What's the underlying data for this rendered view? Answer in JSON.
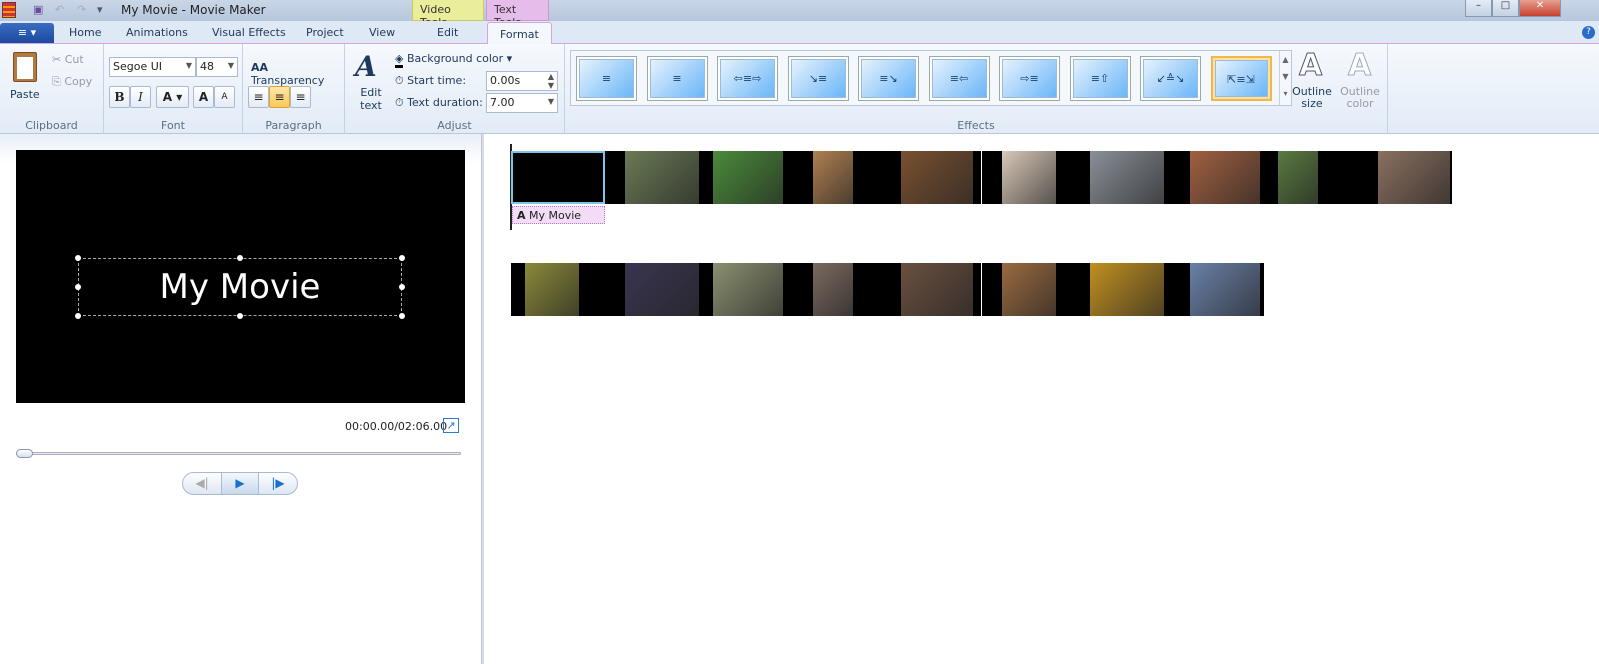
{
  "window": {
    "title": "My Movie - Movie Maker",
    "context_tabs": {
      "video": "Video Tools",
      "text": "Text Tools"
    },
    "controls": {
      "minimize": "–",
      "maximize": "□",
      "close": "✕"
    },
    "help": "?"
  },
  "quick_access": {
    "save": "save-icon",
    "undo": "undo-icon",
    "redo": "redo-icon",
    "customize": "▾"
  },
  "tabs": {
    "file": "≡ ▾",
    "home": "Home",
    "animations": "Animations",
    "visual_effects": "Visual Effects",
    "project": "Project",
    "view": "View",
    "edit": "Edit",
    "format": "Format"
  },
  "ribbon": {
    "clipboard": {
      "label": "Clipboard",
      "paste": "Paste",
      "cut": "Cut",
      "copy": "Copy"
    },
    "font": {
      "label": "Font",
      "family": "Segoe UI",
      "size": "48",
      "bold": "B",
      "italic": "I",
      "color": "A",
      "grow": "A",
      "shrink": "A"
    },
    "paragraph": {
      "label": "Paragraph",
      "transparency": "Transparency",
      "align_selected": "center"
    },
    "adjust": {
      "label": "Adjust",
      "edit_text": "Edit text",
      "background_color": "Background color",
      "start_time_label": "Start time:",
      "start_time": "0.00s",
      "duration_label": "Text duration:",
      "duration": "7.00"
    },
    "effects": {
      "label": "Effects",
      "items": [
        "≡",
        "≡",
        "⇦≡⇨",
        "↘≡",
        "≡↘",
        "≡⇦",
        "⇨≡",
        "≡⇧",
        "↙≙↘",
        "⇱≡⇲"
      ],
      "selected_index": 9,
      "outline_size": "Outline size",
      "outline_color": "Outline color"
    }
  },
  "preview": {
    "text": "My Movie",
    "timecode": "00:00.00/02:06.00",
    "position_fraction": 0,
    "prev": "◀|",
    "play": "▶",
    "next": "|▶"
  },
  "timeline": {
    "caption": "My Movie",
    "caption_icon": "A",
    "row1": [
      "#000000",
      "#6a7a55",
      "#4a8a3a",
      "#b08050",
      "#7a5030",
      "#d8c8b8",
      "#8a9098",
      "#a06040",
      "#5a7a40",
      "#8a7060"
    ],
    "row2": [
      "#8a8a3a",
      "#3a3550",
      "#8a9070",
      "#7a6a60",
      "#6a5040",
      "#9a6a40",
      "#c09020",
      "#6a80a8"
    ]
  }
}
